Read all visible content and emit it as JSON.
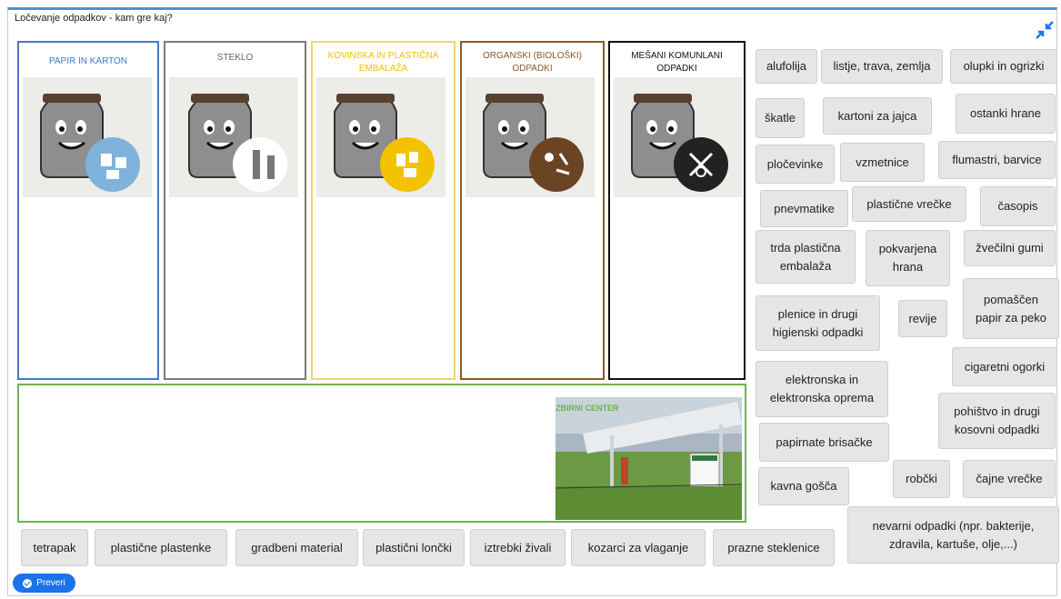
{
  "app": {
    "title": "Ločevanje odpadkov - kam gre kaj?"
  },
  "bins": [
    {
      "label": "PAPIR IN KARTON",
      "color": "#3b7ac4",
      "border": "#4a77c6",
      "symbol_color": "#7fb3dc"
    },
    {
      "label": "STEKLO",
      "color": "#777777",
      "border": "#7b7b7b",
      "symbol_color": "#ffffff"
    },
    {
      "label": "KOVINSKA IN PLASTIČNA EMBALAŽA",
      "color": "#f2c200",
      "border": "#f5d56b",
      "symbol_color": "#f2c200"
    },
    {
      "label": "ORGANSKI (BIOLOŠKI) ODPADKI",
      "color": "#8b5a2b",
      "border": "#8b5a2b",
      "symbol_color": "#6b4423"
    },
    {
      "label": "MEŠANI KOMUNLANI ODPADKI",
      "color": "#111111",
      "border": "#111111",
      "symbol_color": "#222222"
    }
  ],
  "collection_center": {
    "label": "ZBIRNI CENTER",
    "sign_text": "ZBIRNI CENTER JESENICE",
    "border": "#6fb24f"
  },
  "items": {
    "alufolija": "alufolija",
    "listje": "listje, trava, zemlja",
    "olupki": "olupki in ogrizki",
    "skatle": "škatle",
    "kartoni": "kartoni za jajca",
    "ostanki": "ostanki hrane",
    "plocevinke": "pločevinke",
    "vzmetnice": "vzmetnice",
    "flumastri": "flumastri, barvice",
    "pnevmatike": "pnevmatike",
    "vrecke": "plastične vrečke",
    "casopis": "časopis",
    "trda": "trda plastična embalaža",
    "pokvarjena": "pokvarjena hrana",
    "zvecilni": "žvečilni gumi",
    "pomascen": "pomaščen papir za peko",
    "plenice": "plenice in drugi higienski odpadki",
    "revije": "revije",
    "cigaretni": "cigaretni ogorki",
    "elektronska": "elektronska in elektronska oprema",
    "pohistvo": "pohištvo in drugi kosovni odpadki",
    "brisacke": "papirnate brisačke",
    "robcki": "robčki",
    "cajne": "čajne vrečke",
    "kavna": "kavna gošča",
    "nevarni": "nevarni odpadki (npr. bakterije, zdravila, kartuše, olje,...)",
    "tetrapak": "tetrapak",
    "plastenke": "plastične plastenke",
    "gradbeni": "gradbeni material",
    "loncki": "plastični lončki",
    "iztrebki": "iztrebki živali",
    "kozarci": "kozarci za vlaganje",
    "steklenice": "prazne steklenice"
  },
  "check_button": {
    "label": "Preveri"
  },
  "icons": {
    "collapse": "collapse-arrows-icon",
    "check": "check-circle-icon"
  },
  "colors": {
    "accent": "#1a73e8",
    "chip_bg": "#e6e6e6"
  }
}
